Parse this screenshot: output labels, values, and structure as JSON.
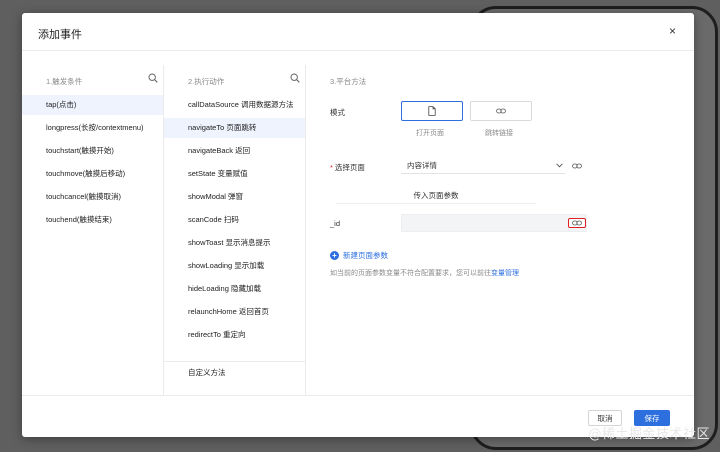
{
  "dialog": {
    "title": "添加事件",
    "close_label": "×"
  },
  "col1": {
    "header": "1.触发条件",
    "items": [
      "tap(点击)",
      "longpress(长按/contextmenu)",
      "touchstart(触摸开始)",
      "touchmove(触摸后移动)",
      "touchcancel(触摸取消)",
      "touchend(触摸结束)"
    ]
  },
  "col2": {
    "header": "2.执行动作",
    "items": [
      "callDataSource 调用数据源方法",
      "navigateTo 页面跳转",
      "navigateBack 返回",
      "setState 变量赋值",
      "showModal 弹窗",
      "scanCode 扫码",
      "showToast 显示消息提示",
      "showLoading 显示加载",
      "hideLoading 隐藏加载",
      "relaunchHome 返回首页",
      "redirectTo 重定向"
    ],
    "custom_method": "自定义方法"
  },
  "col3": {
    "header": "3.平台方法",
    "mode_label": "模式",
    "mode_open_page": "打开页面",
    "mode_jump_link": "跳转链接",
    "select_page_label": "选择页面",
    "select_page_value": "内容详情",
    "pass_params_label": "传入页面参数",
    "param_id_label": "_id",
    "new_param_label": "新建页面参数",
    "hint_text": "如当前的页面参数变量不符合配置要求，您可以前往",
    "hint_link": "变量管理"
  },
  "footer": {
    "cancel_label": "取消",
    "save_label": "保存"
  },
  "watermark": "@稀土掘金技术社区",
  "colors": {
    "accent": "#2d6fdf",
    "danger": "#e02020",
    "active_bg": "#eef3fd"
  }
}
